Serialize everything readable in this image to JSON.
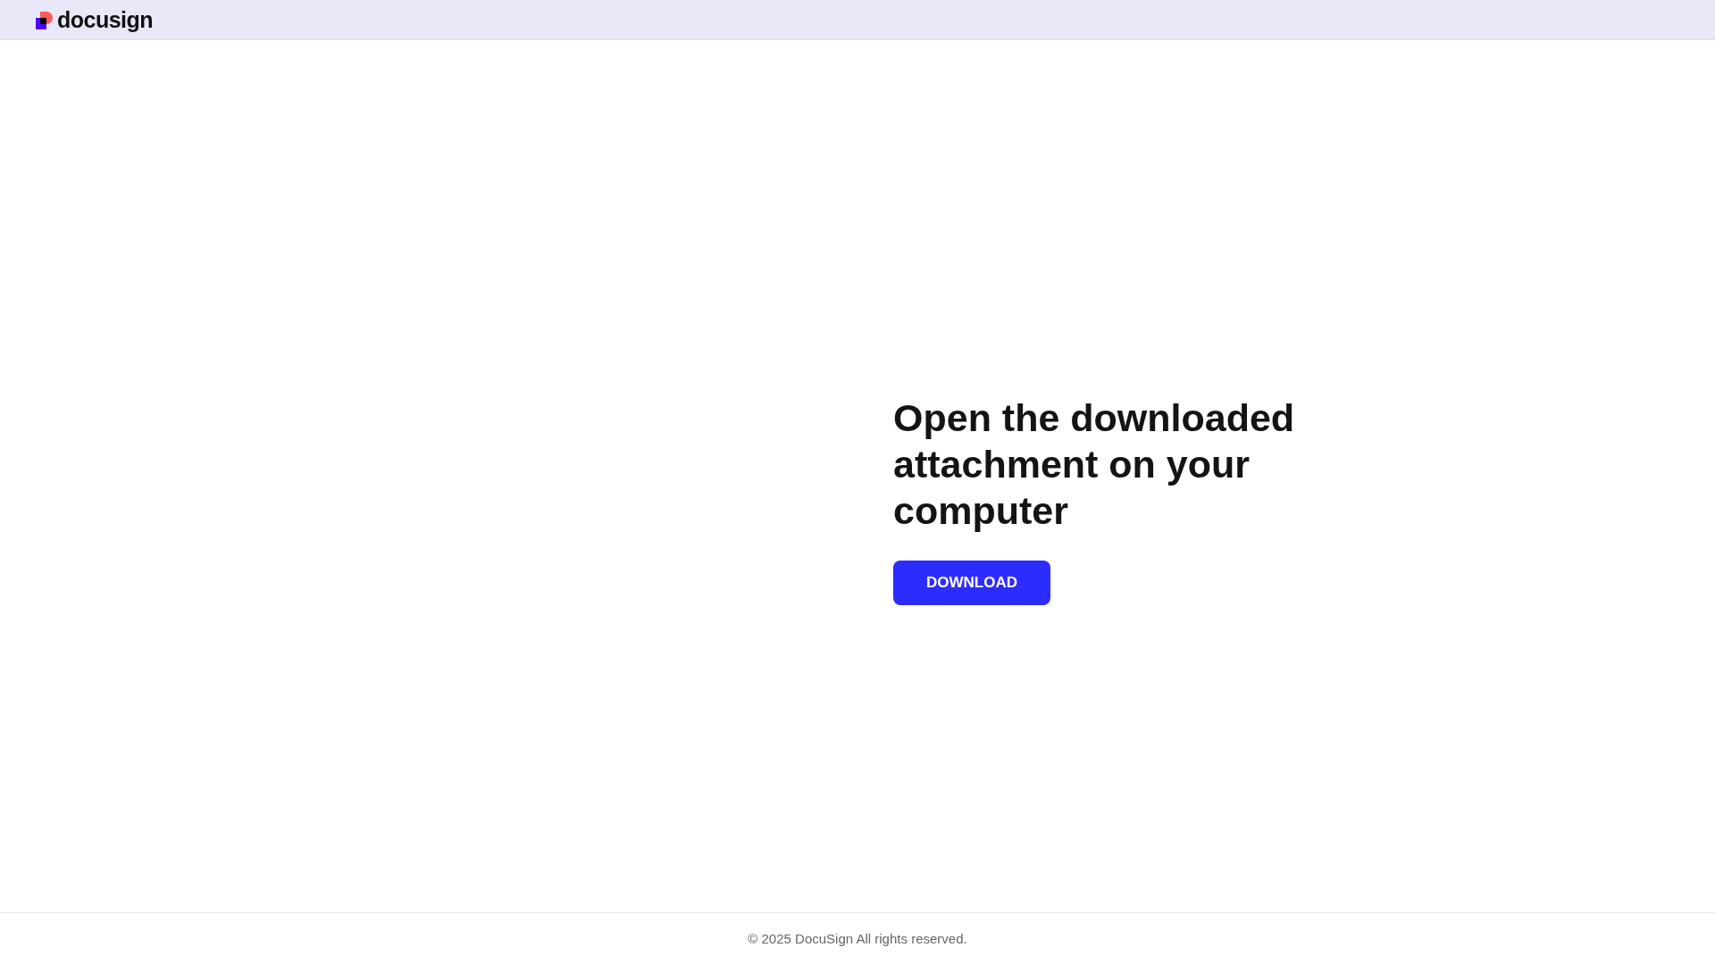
{
  "header": {
    "logo": {
      "wordmark": "docusign"
    }
  },
  "main": {
    "heading": "Open the downloaded attachment on your computer",
    "download_button": {
      "label": "DOWNLOAD"
    }
  },
  "footer": {
    "text": "© 2025 DocuSign All rights reserved."
  }
}
